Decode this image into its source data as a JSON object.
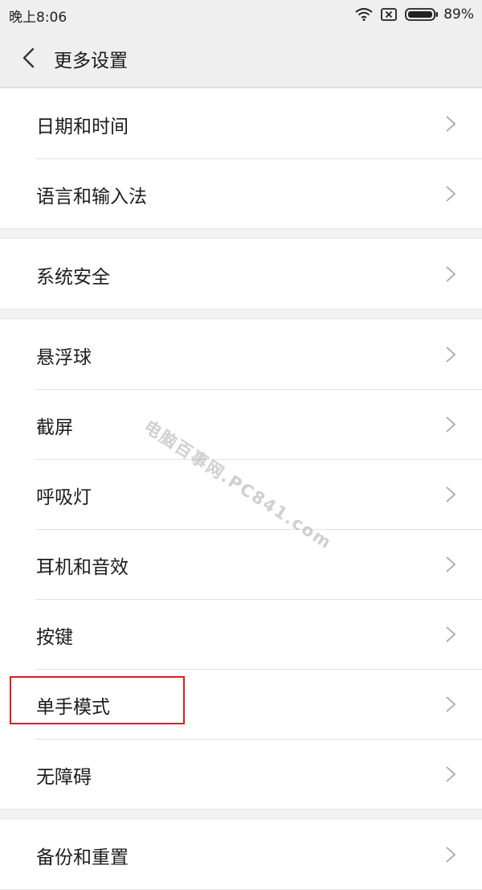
{
  "status_bar": {
    "time": "晚上8:06",
    "battery": "89%",
    "icons": [
      "wifi-icon",
      "sim-none-icon",
      "battery-icon"
    ]
  },
  "header": {
    "title": "更多设置",
    "back_icon": "chevron-left-icon"
  },
  "groups": [
    {
      "items": [
        {
          "label": "日期和时间"
        },
        {
          "label": "语言和输入法"
        }
      ]
    },
    {
      "items": [
        {
          "label": "系统安全"
        }
      ]
    },
    {
      "items": [
        {
          "label": "悬浮球"
        },
        {
          "label": "截屏"
        },
        {
          "label": "呼吸灯"
        },
        {
          "label": "耳机和音效"
        },
        {
          "label": "按键"
        },
        {
          "label": "单手模式",
          "highlighted": true
        },
        {
          "label": "无障碍"
        }
      ]
    },
    {
      "items": [
        {
          "label": "备份和重置"
        }
      ]
    }
  ],
  "highlight_color": "#e11d1d",
  "watermark": "电脑百事网.PC841.com"
}
